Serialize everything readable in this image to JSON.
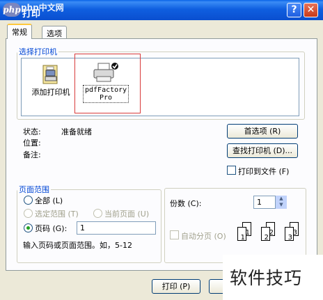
{
  "window": {
    "title": "打印",
    "watermark_top": "php中文网",
    "help_glyph": "?",
    "close_glyph": "✕"
  },
  "tabs": [
    {
      "label": "常规",
      "active": true
    },
    {
      "label": "选项",
      "active": false
    }
  ],
  "select_printer": {
    "legend": "选择打印机",
    "printers": [
      {
        "label": "添加打印机",
        "icon": "add-printer-icon"
      },
      {
        "label_line1": "pdfFactory",
        "label_line2": "Pro",
        "icon": "printer-icon",
        "default": true
      }
    ]
  },
  "status": {
    "status_label": "状态:",
    "status_value": "准备就绪",
    "location_label": "位置:",
    "comment_label": "备注:"
  },
  "buttons": {
    "preferences": "首选项 (R)",
    "find_printer": "查找打印机 (D)...",
    "print_to_file": "打印到文件 (F)",
    "print": "打印 (P)"
  },
  "page_range": {
    "legend": "页面范围",
    "all": "全部 (L)",
    "selection": "选定范围 (T)",
    "current_page": "当前页面 (U)",
    "pages": "页码 (G):",
    "pages_value": "1",
    "hint": "输入页码或页面范围。如，5-12",
    "selected": "pages"
  },
  "copies": {
    "label": "份数 (C):",
    "value": "1",
    "collate": "自动分页 (O)",
    "collate_digits": [
      "1",
      "1",
      "2",
      "2",
      "3",
      "3"
    ]
  },
  "watermark_bottom": "软件技巧"
}
